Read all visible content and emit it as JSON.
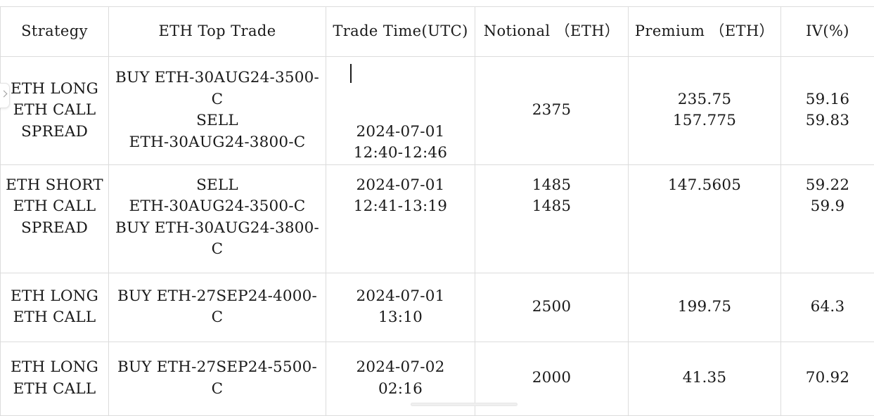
{
  "table": {
    "columns": [
      {
        "key": "strategy",
        "label": "Strategy"
      },
      {
        "key": "top_trade",
        "label": "ETH Top Trade"
      },
      {
        "key": "trade_time",
        "label": "Trade Time(UTC)"
      },
      {
        "key": "notional",
        "label": "Notional （ETH）"
      },
      {
        "key": "premium",
        "label": "Premium （ETH）"
      },
      {
        "key": "iv",
        "label": "IV(%)"
      }
    ],
    "rows": [
      {
        "strategy": "ETH LONG\nETH CALL\nSPREAD",
        "top_trade": "BUY ETH-30AUG24-3500-C\nSELL\nETH-30AUG24-3800-C",
        "trade_time": "2024-07-01\n12:40-12:46",
        "notional": "2375",
        "premium": "235.75\n157.775",
        "iv": "59.16\n59.83"
      },
      {
        "strategy": "ETH SHORT\nETH CALL\nSPREAD",
        "top_trade": "SELL\nETH-30AUG24-3500-C\nBUY ETH-30AUG24-3800-C",
        "trade_time": "2024-07-01\n12:41-13:19",
        "notional": "1485\n1485",
        "premium": "147.5605",
        "iv": "59.22\n59.9"
      },
      {
        "strategy": "ETH LONG\nETH CALL",
        "top_trade": "BUY ETH-27SEP24-4000-C",
        "trade_time": "2024-07-01\n13:10",
        "notional": "2500",
        "premium": "199.75",
        "iv": "64.3"
      },
      {
        "strategy": "ETH LONG\nETH CALL",
        "top_trade": "BUY ETH-27SEP24-5500-C",
        "trade_time": "2024-07-02\n02:16",
        "notional": "2000",
        "premium": "41.35",
        "iv": "70.92"
      }
    ]
  },
  "chrome": {
    "edge_handle_icon": "chevron-right-icon",
    "caret": "text-cursor"
  },
  "colors": {
    "background": "#ffffff",
    "text": "#1a1a1a",
    "border": "#dcdcdc",
    "scrollbar_thumb": "#efefef"
  }
}
